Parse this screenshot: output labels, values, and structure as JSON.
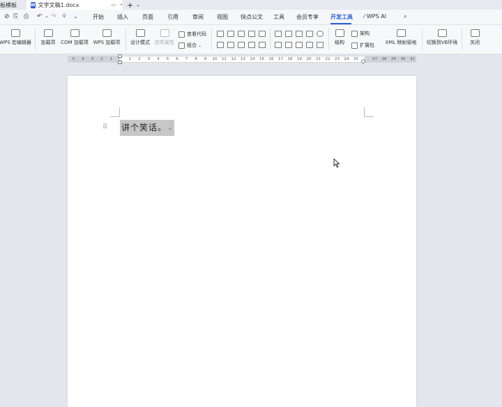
{
  "tabs": {
    "template": "板模板",
    "doc_title": "文字文稿1.docx",
    "new_tab": "+"
  },
  "menu": {
    "items": [
      "开始",
      "插入",
      "页面",
      "引用",
      "审阅",
      "视图",
      "快点公文",
      "工具",
      "会员专享",
      "开发工具",
      "WPS AI"
    ],
    "active": "开发工具"
  },
  "ribbon": {
    "wps_macro_editor": "WPS 宏编辑器",
    "addins": "加载项",
    "com_addins": "COM 加载项",
    "wps_addins": "WPS 加载项",
    "design_mode": "设计模式",
    "control_props": "控件属性",
    "view_code": "查看代码",
    "group": "组合",
    "structure": "结构",
    "schema": "架构",
    "expansion_pack": "扩展包",
    "xml_mapping": "XML 映射窗格",
    "switch_vb": "切换到VB环境",
    "close": "关闭"
  },
  "ruler": {
    "left_nums": [
      "5",
      "4",
      "3",
      "2",
      "1"
    ],
    "right_nums": [
      "1",
      "2",
      "3",
      "4",
      "5",
      "6",
      "7",
      "8",
      "9",
      "10",
      "11",
      "12",
      "13",
      "14",
      "15",
      "16",
      "17",
      "18",
      "19",
      "20",
      "21",
      "22",
      "23",
      "24",
      "25",
      "",
      "27",
      "28",
      "29",
      "30",
      "31"
    ]
  },
  "document": {
    "text": "讲个笑话。"
  }
}
